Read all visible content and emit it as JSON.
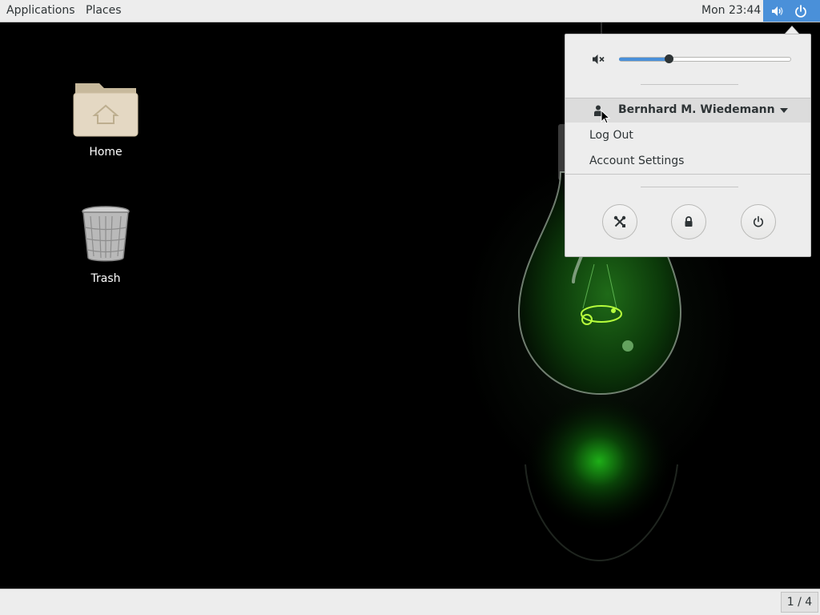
{
  "top_bar": {
    "applications_label": "Applications",
    "places_label": "Places",
    "clock": "Mon 23:44",
    "indicators": [
      "volume-icon",
      "power-icon"
    ],
    "accent_color": "#4a90d9"
  },
  "desktop": {
    "icons": [
      {
        "label": "Home",
        "icon": "home-folder-icon"
      },
      {
        "label": "Trash",
        "icon": "trash-icon"
      }
    ]
  },
  "system_menu": {
    "volume": {
      "icon": "volume-muted-icon",
      "level": 0.29
    },
    "user": {
      "name": "Bernhard M. Wiedemann",
      "icon": "user-icon",
      "items": [
        {
          "label": "Log Out"
        },
        {
          "label": "Account Settings"
        }
      ]
    },
    "actions": [
      {
        "icon": "settings-icon"
      },
      {
        "icon": "lock-icon"
      },
      {
        "icon": "power-off-icon"
      }
    ]
  },
  "bottom_bar": {
    "workspace": "1 / 4"
  }
}
